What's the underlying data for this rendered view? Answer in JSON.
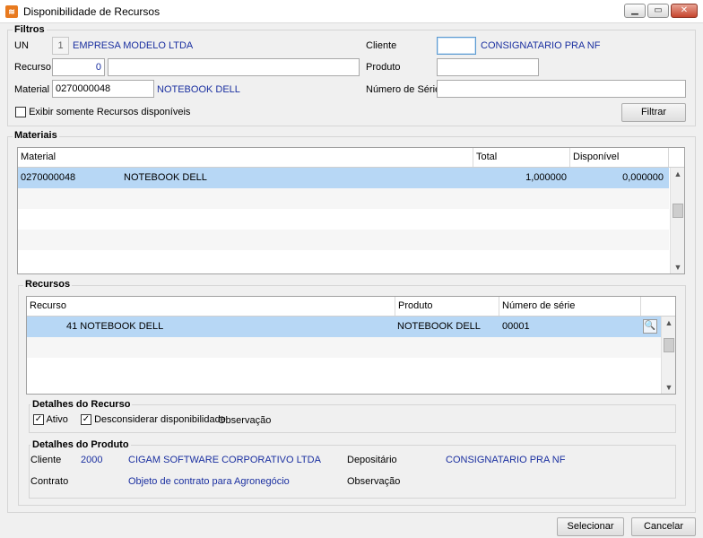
{
  "window": {
    "title": "Disponibilidade de Recursos",
    "icon": "app-icon"
  },
  "filtros": {
    "group_title": "Filtros",
    "un_label": "UN",
    "un_code": "1",
    "un_name": "EMPRESA MODELO LTDA",
    "recurso_label": "Recurso",
    "recurso_code": "0",
    "recurso_desc": "",
    "material_label": "Material",
    "material_code": "0270000048",
    "material_name": "NOTEBOOK DELL",
    "cliente_label": "Cliente",
    "cliente_value": "",
    "cliente_name": "CONSIGNATARIO PRA NF",
    "produto_label": "Produto",
    "produto_value": "",
    "serie_label": "Número de Série",
    "serie_value": "",
    "checkbox_label": "Exibir somente Recursos disponíveis",
    "filtrar_label": "Filtrar"
  },
  "materiais": {
    "group_title": "Materiais",
    "columns": [
      "Material",
      "Total",
      "Disponível"
    ],
    "rows": [
      {
        "material": "0270000048",
        "name": "NOTEBOOK DELL",
        "total": "1,000000",
        "disponivel": "0,000000"
      }
    ]
  },
  "recursos": {
    "group_title": "Recursos",
    "columns": [
      "Recurso",
      "Produto",
      "Número de série"
    ],
    "rows": [
      {
        "recurso": "41 NOTEBOOK DELL",
        "produto": "NOTEBOOK DELL",
        "serie": "00001"
      }
    ]
  },
  "detalhes_recurso": {
    "group_title": "Detalhes do Recurso",
    "ativo_label": "Ativo",
    "desconsiderar_label": "Desconsiderar disponibilidade",
    "observacao_label": "Observação"
  },
  "detalhes_produto": {
    "group_title": "Detalhes do Produto",
    "cliente_label": "Cliente",
    "cliente_code": "2000",
    "cliente_name": "CIGAM SOFTWARE CORPORATIVO LTDA",
    "depositario_label": "Depositário",
    "depositario_name": "CONSIGNATARIO PRA NF",
    "contrato_label": "Contrato",
    "contrato_value": "Objeto de contrato para Agronegócio",
    "observacao_label": "Observação"
  },
  "footer": {
    "selecionar_label": "Selecionar",
    "cancelar_label": "Cancelar"
  }
}
